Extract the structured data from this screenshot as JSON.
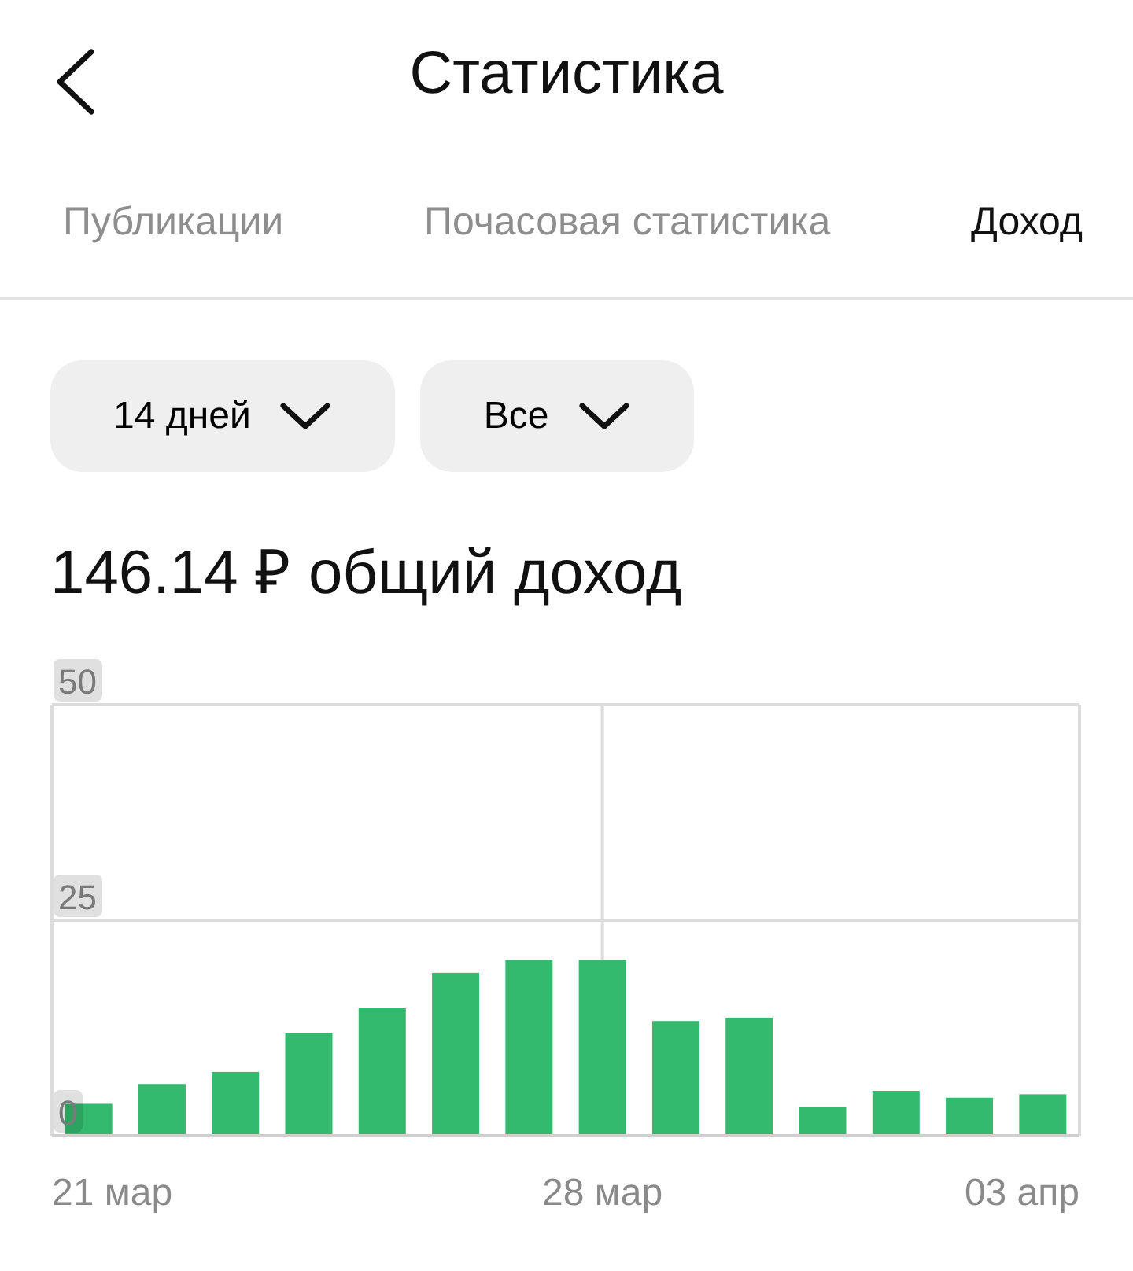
{
  "header": {
    "title": "Статистика"
  },
  "tabs": [
    {
      "label": "Публикации",
      "selected": false
    },
    {
      "label": "Почасовая статистика",
      "selected": false
    },
    {
      "label": "Доход",
      "selected": true
    }
  ],
  "filters": [
    {
      "label": "14 дней"
    },
    {
      "label": "Все"
    }
  ],
  "total": {
    "amount": "146.14 ₽",
    "caption": "общий доход"
  },
  "chart_data": {
    "type": "bar",
    "color": "#34ba6e",
    "values": [
      3.7,
      6,
      7.4,
      11.9,
      14.8,
      18.9,
      20.4,
      20.4,
      13.3,
      13.7,
      3.3,
      5.2,
      4.4,
      4.8
    ],
    "ylim": [
      0,
      50
    ],
    "yticks": [
      0,
      25,
      50
    ],
    "categories": [
      "21 мар",
      null,
      null,
      null,
      null,
      null,
      null,
      "28 мар",
      null,
      null,
      null,
      null,
      null,
      "03 апр"
    ]
  }
}
